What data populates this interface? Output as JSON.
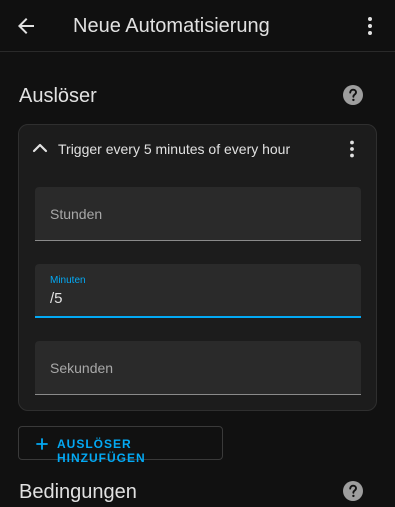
{
  "appbar": {
    "title": "Neue Automatisierung",
    "icons": [
      "back-arrow-icon",
      "more-vertical-icon"
    ]
  },
  "triggers": {
    "heading": "Auslöser",
    "help_icon": "help-circle-icon",
    "card": {
      "title": "Trigger every 5 minutes of every hour",
      "expanded": true,
      "fields": [
        {
          "label": "Stunden",
          "value": "",
          "focused": false
        },
        {
          "label": "Minuten",
          "value": "/5",
          "focused": true
        },
        {
          "label": "Sekunden",
          "value": "",
          "focused": false
        }
      ]
    },
    "add_button": "AUSLÖSER HINZUFÜGEN"
  },
  "conditions": {
    "heading": "Bedingungen",
    "help_icon": "help-circle-icon"
  },
  "colors": {
    "accent": "#03a9f4",
    "background": "#111111",
    "card": "#1c1c1c",
    "field": "#2a2a2a",
    "text": "#e1e1e1"
  }
}
